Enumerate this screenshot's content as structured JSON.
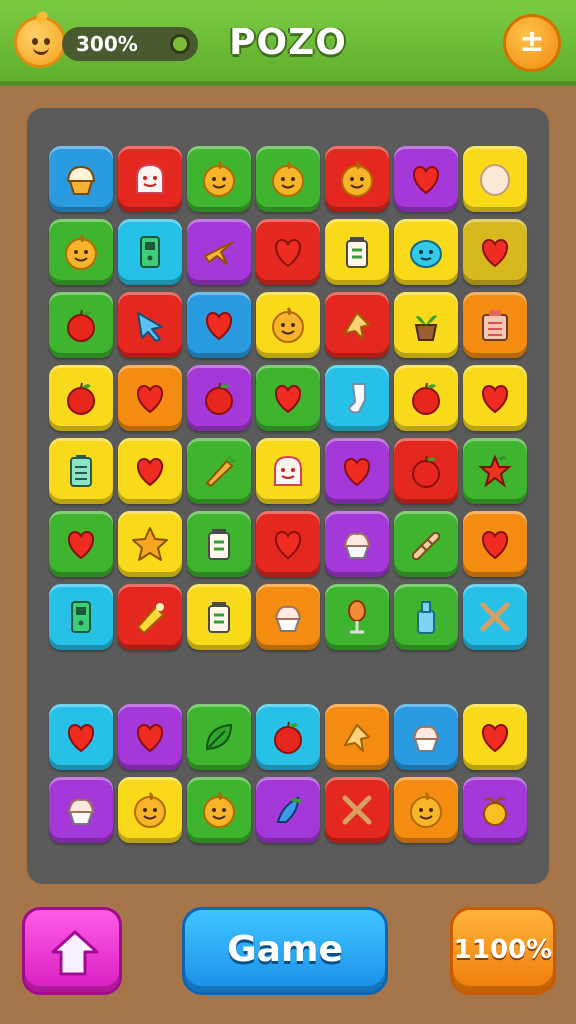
{
  "header": {
    "score": "300%",
    "title": "POZO",
    "right_button_label": "±"
  },
  "footer": {
    "game_label": "Game",
    "right_label": "1100%"
  },
  "colors": {
    "blue": "#2a9be0",
    "red": "#e5281f",
    "green": "#3fb52f",
    "yellow": "#f8da1a",
    "purple": "#a438d8",
    "orange": "#f58c12",
    "cyan": "#27c1e8",
    "olive": "#d7b81e"
  },
  "grid_main": [
    [
      [
        "blue",
        "muffin"
      ],
      [
        "red",
        "ghost-face"
      ],
      [
        "green",
        "smiley"
      ],
      [
        "green",
        "smiley"
      ],
      [
        "red",
        "smiley"
      ],
      [
        "purple",
        "heart"
      ],
      [
        "yellow",
        "egg"
      ]
    ],
    [
      [
        "green",
        "smiley"
      ],
      [
        "cyan",
        "phone"
      ],
      [
        "purple",
        "plane"
      ],
      [
        "red",
        "heart"
      ],
      [
        "yellow",
        "jar"
      ],
      [
        "yellow",
        "blob-face"
      ],
      [
        "olive",
        "heart"
      ]
    ],
    [
      [
        "green",
        "apple"
      ],
      [
        "red",
        "arrow"
      ],
      [
        "blue",
        "heart"
      ],
      [
        "yellow",
        "smiley"
      ],
      [
        "red",
        "paper"
      ],
      [
        "yellow",
        "plant-pot"
      ],
      [
        "orange",
        "radio"
      ]
    ],
    [
      [
        "yellow",
        "apple"
      ],
      [
        "orange",
        "heart"
      ],
      [
        "purple",
        "apple"
      ],
      [
        "green",
        "heart"
      ],
      [
        "cyan",
        "sock"
      ],
      [
        "yellow",
        "apple"
      ],
      [
        "yellow",
        "heart"
      ]
    ],
    [
      [
        "yellow",
        "battery"
      ],
      [
        "yellow",
        "heart"
      ],
      [
        "green",
        "carrot"
      ],
      [
        "yellow",
        "ghost-face"
      ],
      [
        "purple",
        "heart"
      ],
      [
        "red",
        "apple"
      ],
      [
        "green",
        "star-fruit"
      ]
    ],
    [
      [
        "green",
        "heart"
      ],
      [
        "yellow",
        "star"
      ],
      [
        "green",
        "jar"
      ],
      [
        "red",
        "heart"
      ],
      [
        "purple",
        "cupcake"
      ],
      [
        "green",
        "bread"
      ],
      [
        "orange",
        "heart"
      ]
    ],
    [
      [
        "cyan",
        "phone"
      ],
      [
        "red",
        "star-burst"
      ],
      [
        "yellow",
        "jar"
      ],
      [
        "orange",
        "cupcake"
      ],
      [
        "green",
        "spoon"
      ],
      [
        "green",
        "bottle"
      ],
      [
        "cyan",
        "cross"
      ]
    ]
  ],
  "grid_lower": [
    [
      [
        "cyan",
        "heart"
      ],
      [
        "purple",
        "heart"
      ],
      [
        "green",
        "leaf"
      ],
      [
        "cyan",
        "apple"
      ],
      [
        "orange",
        "paper"
      ],
      [
        "blue",
        "cupcake"
      ],
      [
        "yellow",
        "heart"
      ]
    ],
    [
      [
        "purple",
        "cupcake"
      ],
      [
        "yellow",
        "smiley"
      ],
      [
        "green",
        "smiley"
      ],
      [
        "purple",
        "feather"
      ],
      [
        "red",
        "cross"
      ],
      [
        "orange",
        "smiley"
      ],
      [
        "purple",
        "fruit"
      ]
    ]
  ]
}
